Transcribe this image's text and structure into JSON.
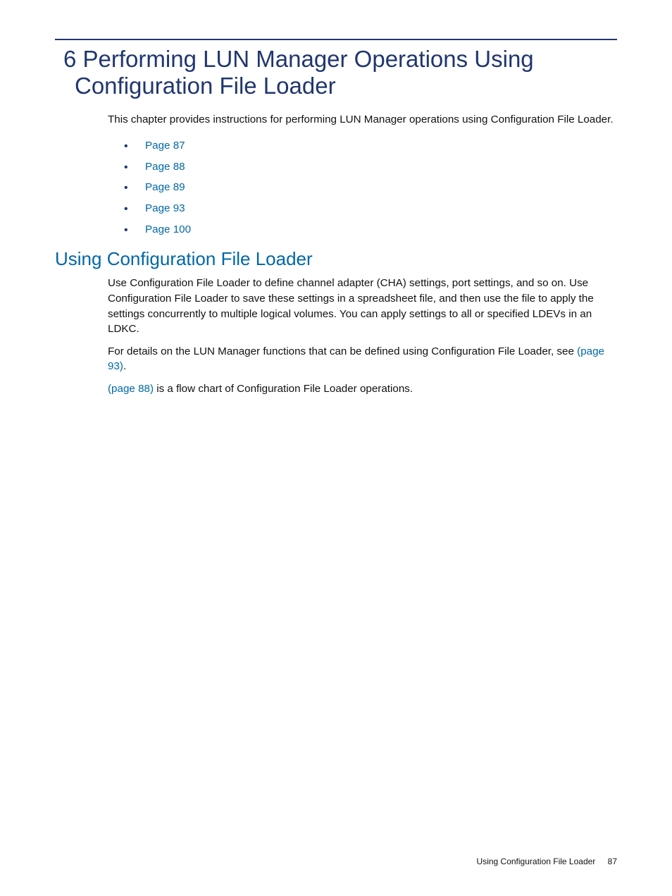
{
  "chapter": {
    "number": "6",
    "title": "Performing LUN Manager Operations Using Configuration File Loader"
  },
  "intro": "This chapter provides instructions for performing LUN Manager operations using Configuration File Loader.",
  "toc_links": [
    {
      "label": "Page 87"
    },
    {
      "label": "Page 88"
    },
    {
      "label": "Page 89"
    },
    {
      "label": "Page 93"
    },
    {
      "label": "Page 100"
    }
  ],
  "section": {
    "title": "Using Configuration File Loader",
    "para1": "Use Configuration File Loader to define channel adapter (CHA) settings, port settings, and so on. Use Configuration File Loader to save these settings in a spreadsheet file, and then use the file to apply the settings concurrently to multiple logical volumes. You can apply settings to all or specified LDEVs in an LDKC.",
    "para2_pre": "For details on the LUN Manager functions that can be defined using Configuration File Loader, see ",
    "para2_link": "(page 93)",
    "para2_post": ".",
    "para3_link": "(page 88)",
    "para3_post": " is a flow chart of Configuration File Loader operations."
  },
  "footer": {
    "section_label": "Using Configuration File Loader",
    "page_number": "87"
  }
}
